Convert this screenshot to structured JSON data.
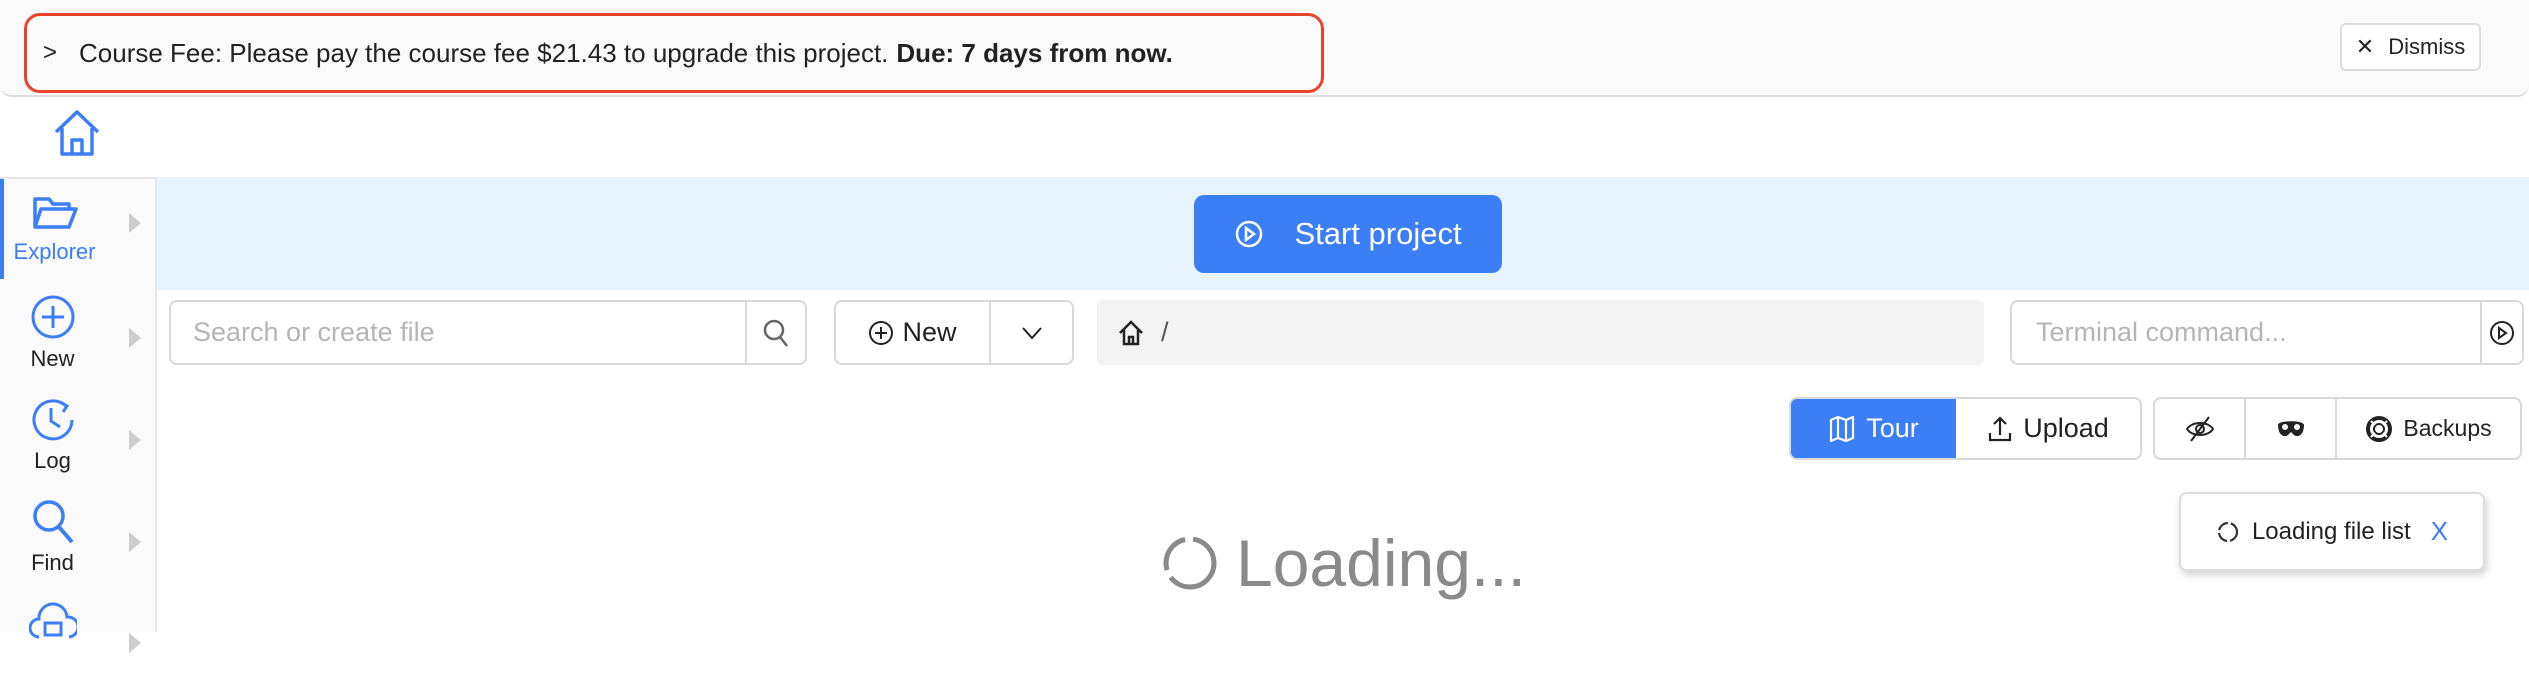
{
  "banner": {
    "prefix": "Course Fee: Please pay the course fee $21.43 to upgrade this project.",
    "due": "Due: 7 days from now.",
    "dismiss_label": "Dismiss"
  },
  "sidebar": {
    "items": [
      {
        "label": "Explorer",
        "icon": "folder-open-icon",
        "active": true
      },
      {
        "label": "New",
        "icon": "plus-circle-icon"
      },
      {
        "label": "Log",
        "icon": "history-icon"
      },
      {
        "label": "Find",
        "icon": "search-icon"
      },
      {
        "label": "",
        "icon": "cloud-icon"
      }
    ]
  },
  "start_label": "Start project",
  "search": {
    "placeholder": "Search or create file"
  },
  "new_label": "New",
  "path": "/",
  "terminal": {
    "placeholder": "Terminal command..."
  },
  "actions": {
    "tour": "Tour",
    "upload": "Upload",
    "backups": "Backups"
  },
  "toast": {
    "text": "Loading file list",
    "close": "X"
  },
  "loading": "Loading...",
  "colors": {
    "accent": "#3b7ef5",
    "band": "#e7f3fe",
    "highlight": "#e8442c"
  }
}
